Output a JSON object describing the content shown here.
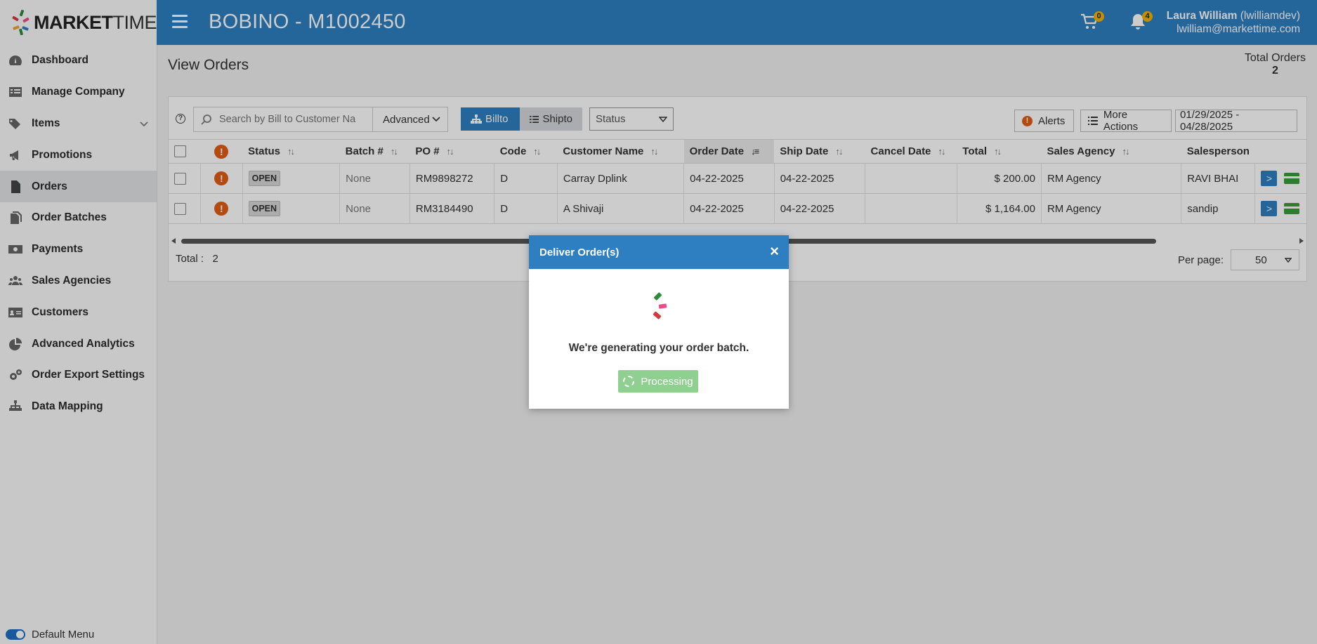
{
  "brand": {
    "logo_text_bold": "MARKET",
    "logo_text_light": "TIME",
    "colors": {
      "primary": "#2d7fc1",
      "alert": "#e25d14",
      "badge": "#f0b400",
      "success": "#3a9b3a"
    }
  },
  "sidebar": {
    "items": [
      {
        "label": "Dashboard",
        "icon": "dashboard-icon"
      },
      {
        "label": "Manage Company",
        "icon": "list-icon"
      },
      {
        "label": "Items",
        "icon": "tags-icon"
      },
      {
        "label": "Promotions",
        "icon": "bullhorn-icon"
      },
      {
        "label": "Orders",
        "icon": "file-icon"
      },
      {
        "label": "Order Batches",
        "icon": "files-icon"
      },
      {
        "label": "Payments",
        "icon": "money-icon"
      },
      {
        "label": "Sales Agencies",
        "icon": "users-icon"
      },
      {
        "label": "Customers",
        "icon": "id-card-icon"
      },
      {
        "label": "Advanced Analytics",
        "icon": "pie-chart-icon"
      },
      {
        "label": "Order Export Settings",
        "icon": "gears-icon"
      },
      {
        "label": "Data Mapping",
        "icon": "sitemap-icon"
      }
    ],
    "default_menu_label": "Default Menu"
  },
  "header": {
    "title": "BOBINO - M1002450",
    "cart_count": "0",
    "notification_count": "4",
    "user_name": "Laura William",
    "user_handle": "(lwilliamdev)",
    "user_email": "lwilliam@markettime.com"
  },
  "page": {
    "title": "View Orders",
    "total_orders_label": "Total Orders",
    "total_orders_value": "2"
  },
  "toolbar": {
    "search_placeholder": "Search by Bill to Customer Na",
    "advanced_label": "Advanced",
    "billto_label": "Billto",
    "shipto_label": "Shipto",
    "status_label": "Status",
    "alerts_label": "Alerts",
    "more_actions_label": "More Actions",
    "date_range": "01/29/2025 - 04/28/2025"
  },
  "table": {
    "columns": [
      "Status",
      "Batch #",
      "PO #",
      "Code",
      "Customer Name",
      "Order Date",
      "Ship Date",
      "Cancel Date",
      "Total",
      "Sales Agency",
      "Salesperson"
    ],
    "rows": [
      {
        "status": "OPEN",
        "batch": "None",
        "po": "RM9898272",
        "code": "D",
        "customer": "Carray Dplink",
        "order_date": "04-22-2025",
        "ship_date": "04-22-2025",
        "cancel_date": "",
        "total": "$ 200.00",
        "agency": "RM Agency",
        "salesperson": "RAVI BHAI"
      },
      {
        "status": "OPEN",
        "batch": "None",
        "po": "RM3184490",
        "code": "D",
        "customer": "A Shivaji",
        "order_date": "04-22-2025",
        "ship_date": "04-22-2025",
        "cancel_date": "",
        "total": "$ 1,164.00",
        "agency": "RM Agency",
        "salesperson": "sandip"
      }
    ]
  },
  "footer": {
    "total_label": "Total :",
    "total_value": "2",
    "per_page_label": "Per page:",
    "per_page_value": "50"
  },
  "modal": {
    "title": "Deliver Order(s)",
    "message": "We're generating your order batch.",
    "button_label": "Processing"
  }
}
